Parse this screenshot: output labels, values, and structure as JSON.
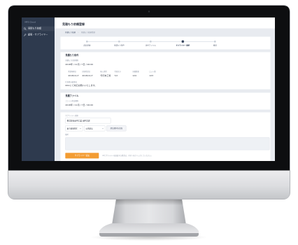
{
  "app": {
    "brand": "MFS Cloud"
  },
  "sidebar": {
    "items": [
      {
        "label": "見積もり依頼",
        "icon": "search-icon"
      },
      {
        "label": "顧客・サプライヤー",
        "icon": "wrench-icon"
      }
    ]
  },
  "header": {
    "title": "見積もり依頼登録"
  },
  "breadcrumb": [
    "見積もり依頼",
    "見積もり依頼登録"
  ],
  "breadcrumb_separator": "›",
  "steps": [
    {
      "label": "部品登録"
    },
    {
      "label": "見積もり条件"
    },
    {
      "label": "添付ファイル"
    },
    {
      "label": "サプライヤー選択",
      "current": true
    },
    {
      "label": "確認"
    }
  ],
  "conditions": {
    "heading": "見積もり条件",
    "deadline_label": "見積もり回答期限",
    "deadline_value": "2018年 / 11月 / 7日 / 00:00",
    "columns": [
      {
        "label": "希望納期日",
        "value": "2018/11/7"
      },
      {
        "label": "回答希望日",
        "value": "2018/11/7"
      },
      {
        "label": "納入場所",
        "value": "代行本工場"
      },
      {
        "label": "手配区分",
        "value": "7/2"
      },
      {
        "label": "見積数量",
        "value": "124"
      },
      {
        "label": "ロット数",
        "value": "123"
      }
    ],
    "spec_label": "仕様書記載事項",
    "spec_value": "ZACにて対応お願いいたします。"
  },
  "files": {
    "heading": "見積ファイル",
    "deadline_label": "ファイル提出期限",
    "deadline_value": "2018年 / 11月 / 7日 / 00:00"
  },
  "supplier": {
    "label": "サプライヤー選択",
    "company_value": "株式会社田中工業 田中太郎",
    "region_value": "東京都墨田区",
    "category_value": "山田部品",
    "add_filter_button": "部品選択を追加",
    "notes_label": "備考",
    "add_button": "サプライヤー追加",
    "add_note": "※サプライヤーを追加する場合は、ボタンをクリックしてください。"
  },
  "colors": {
    "sidebar_bg": "#2e3a4e",
    "main_bg": "#e8ebf0",
    "panel_bg": "#ffffff",
    "accent": "#f39c32",
    "text_primary": "#2f3542",
    "text_muted": "#8a93a3",
    "step_active": "#34425a",
    "bezel": "#0d0e10"
  }
}
